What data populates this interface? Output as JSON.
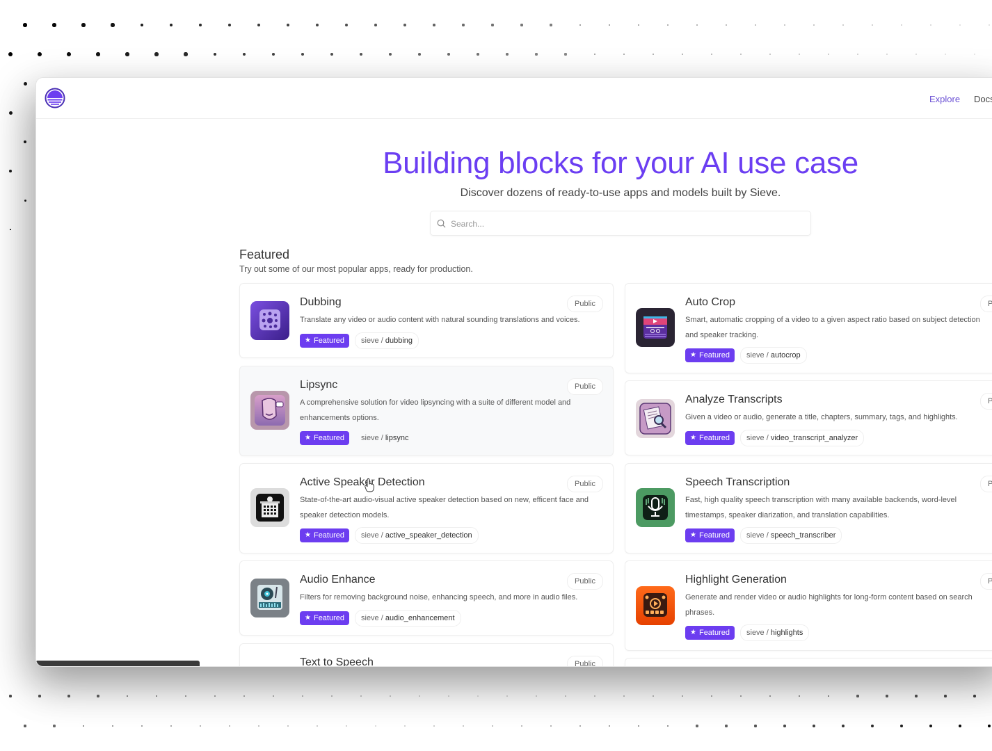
{
  "header": {
    "logo": "sieve-logo-icon",
    "nav": [
      {
        "label": "Explore",
        "active": true
      },
      {
        "label": "Docs",
        "active": false
      }
    ]
  },
  "hero": {
    "title": "Building blocks for your AI use case",
    "subtitle": "Discover dozens of ready-to-use apps and models built by Sieve.",
    "search_placeholder": "Search...",
    "search_value": ""
  },
  "featured": {
    "title": "Featured",
    "subtitle": "Try out some of our most popular apps, ready for production.",
    "featured_label": "Featured",
    "visibility_label": "Public",
    "left_column": [
      {
        "title": "Dubbing",
        "description": "Translate any video or audio content with natural sounding translations and voices.",
        "owner": "sieve",
        "slug": "dubbing",
        "icon": "dubbing-icon",
        "hovered": false
      },
      {
        "title": "Lipsync",
        "description": "A comprehensive solution for video lipsyncing with a suite of different model and enhancements options.",
        "owner": "sieve",
        "slug": "lipsync",
        "icon": "lipsync-icon",
        "hovered": true
      },
      {
        "title": "Active Speaker Detection",
        "description": "State-of-the-art audio-visual active speaker detection based on new, efficent face and speaker detection models.",
        "owner": "sieve",
        "slug": "active_speaker_detection",
        "icon": "active-speaker-icon",
        "hovered": false
      },
      {
        "title": "Audio Enhance",
        "description": "Filters for removing background noise, enhancing speech, and more in audio files.",
        "owner": "sieve",
        "slug": "audio_enhancement",
        "icon": "audio-enhance-icon",
        "hovered": false
      },
      {
        "title": "Text to Speech",
        "description": "",
        "owner": "",
        "slug": "",
        "icon": "",
        "hovered": false
      }
    ],
    "right_column": [
      {
        "title": "Auto Crop",
        "description": "Smart, automatic cropping of a video to a given aspect ratio based on subject detection and speaker tracking.",
        "owner": "sieve",
        "slug": "autocrop",
        "icon": "autocrop-icon",
        "hovered": false
      },
      {
        "title": "Analyze Transcripts",
        "description": "Given a video or audio, generate a title, chapters, summary, tags, and highlights.",
        "owner": "sieve",
        "slug": "video_transcript_analyzer",
        "icon": "analyze-transcripts-icon",
        "hovered": false
      },
      {
        "title": "Speech Transcription",
        "description": "Fast, high quality speech transcription with many available backends, word-level timestamps, speaker diarization, and translation capabilities.",
        "owner": "sieve",
        "slug": "speech_transcriber",
        "icon": "speech-transcription-icon",
        "hovered": false
      },
      {
        "title": "Highlight Generation",
        "description": "Generate and render video or audio highlights for long-form content based on search phrases.",
        "owner": "sieve",
        "slug": "highlights",
        "icon": "highlights-icon",
        "hovered": false
      }
    ]
  },
  "colors": {
    "accent": "#6c3df0",
    "title": "#6b3ef2",
    "nav_active": "#6a4fd4"
  }
}
